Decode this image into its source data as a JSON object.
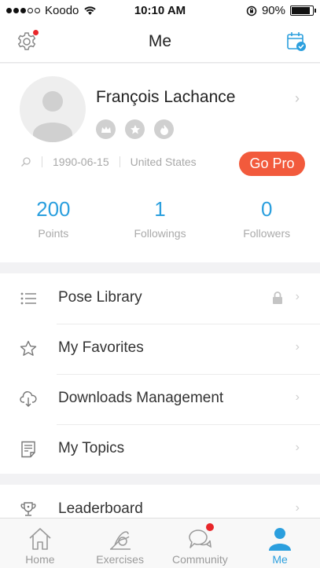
{
  "status_bar": {
    "carrier": "Koodo",
    "time": "10:10 AM",
    "battery": "90%",
    "signal_bars_filled": 3,
    "signal_bars_total": 5,
    "battery_level": 0.9
  },
  "nav": {
    "title": "Me",
    "left_icon": "gear-icon",
    "right_icon": "calendar-icon",
    "settings_has_notification": true
  },
  "profile": {
    "name": "François Lachance",
    "birthdate": "1990-06-15",
    "country": "United States",
    "go_pro_label": "Go Pro",
    "badges": [
      "crown-icon",
      "star-icon",
      "flame-icon"
    ],
    "stats": [
      {
        "value": "200",
        "label": "Points"
      },
      {
        "value": "1",
        "label": "Followings"
      },
      {
        "value": "0",
        "label": "Followers"
      }
    ]
  },
  "menu": {
    "items": [
      {
        "label": "Pose Library",
        "icon": "list-icon",
        "locked": true
      },
      {
        "label": "My Favorites",
        "icon": "star-icon",
        "locked": false
      },
      {
        "label": "Downloads Management",
        "icon": "cloud-download-icon",
        "locked": false
      },
      {
        "label": "My Topics",
        "icon": "document-icon",
        "locked": false
      }
    ],
    "section2": [
      {
        "label": "Leaderboard",
        "icon": "trophy-icon"
      }
    ]
  },
  "tabs": [
    {
      "label": "Home",
      "icon": "home-icon",
      "active": false
    },
    {
      "label": "Exercises",
      "icon": "exercises-icon",
      "active": false
    },
    {
      "label": "Community",
      "icon": "community-icon",
      "active": false,
      "badge": true
    },
    {
      "label": "Me",
      "icon": "person-icon",
      "active": true
    }
  ],
  "colors": {
    "accent": "#2b9fde",
    "go_pro": "#f25a3c",
    "badge_red": "#e8262a"
  }
}
